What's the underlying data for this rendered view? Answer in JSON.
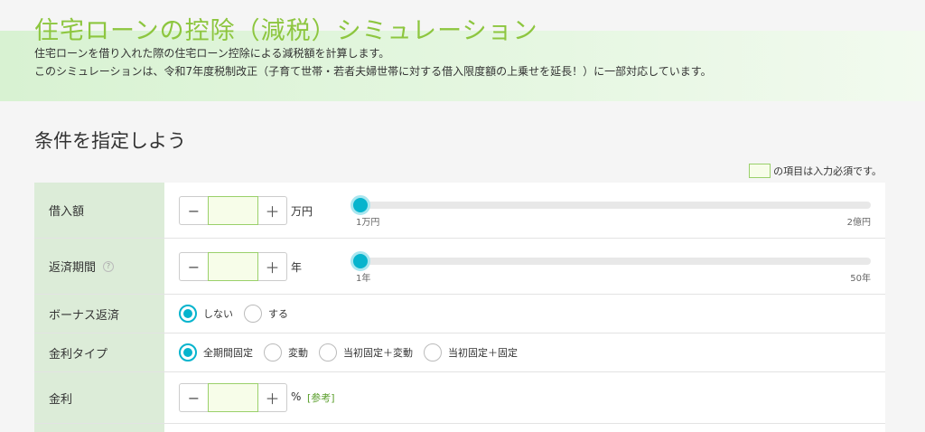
{
  "header": {
    "title": "住宅ローンの控除（減税）シミュレーション",
    "subtitle_1": "住宅ローンを借り入れた際の住宅ローン控除による減税額を計算します。",
    "subtitle_2": "このシミュレーションは、令和7年度税制改正（子育て世帯・若者夫婦世帯に対する借入限度額の上乗せを延長！）に一部対応しています。"
  },
  "section": {
    "title": "条件を指定しよう",
    "required_note": "の項目は入力必須です。"
  },
  "form": {
    "loan_amount": {
      "label": "借入額",
      "minus": "−",
      "plus": "＋",
      "value": "",
      "unit": "万円",
      "slider_min": "1万円",
      "slider_max": "2億円",
      "slider_position": 0
    },
    "loan_term": {
      "label": "返済期間",
      "help": "?",
      "minus": "−",
      "plus": "＋",
      "value": "",
      "unit": "年",
      "slider_min": "1年",
      "slider_max": "50年",
      "slider_position": 0
    },
    "bonus": {
      "label": "ボーナス返済",
      "options": [
        "しない",
        "する"
      ],
      "selected": "しない"
    },
    "rate_type": {
      "label": "金利タイプ",
      "options": [
        "全期間固定",
        "変動",
        "当初固定＋変動",
        "当初固定＋固定"
      ],
      "selected": "全期間固定"
    },
    "interest_rate": {
      "label": "金利",
      "minus": "−",
      "plus": "＋",
      "value": "",
      "unit": "%",
      "reference": "[参考]"
    }
  },
  "colors": {
    "accent": "#06b4cd",
    "title_green": "#8dc63f",
    "label_bg": "#dcecd8",
    "input_bg": "#f7fde9",
    "input_border": "#9ad06a"
  }
}
